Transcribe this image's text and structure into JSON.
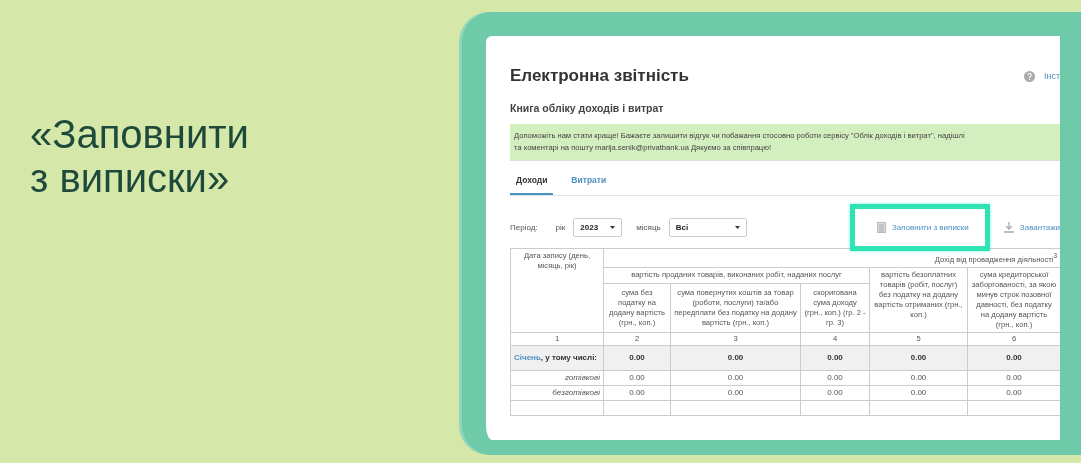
{
  "heading": "«Заповнити з виписки»",
  "app": {
    "title": "Електронна звітність",
    "help_link": "Інст",
    "subtitle": "Книга обліку доходів і витрат",
    "notice_lines": [
      "Допоможіть нам стати краще! Бажаєте залишити відгук чи побажання стосовно роботи сервісу \"Облік доходів і витрат\", надішлі",
      "та коментарі на пошту marija.senik@privatbank.ua Дякуємо за співпрацю!"
    ],
    "tabs": [
      {
        "label": "Доходи",
        "selected": true
      },
      {
        "label": "Витрати",
        "selected": false
      }
    ],
    "filters": {
      "period_label": "Період:",
      "year_label": "рік",
      "year": "2023",
      "month_label": "місяць",
      "month": "Всі"
    },
    "actions": [
      {
        "kind": "list",
        "label": "Заповнити з виписки",
        "highlighted": true
      },
      {
        "kind": "download",
        "label": "Завантажи",
        "highlighted": false
      }
    ],
    "table": {
      "date_header": "Дата запису (день, місяць, рік)",
      "income_header": "Дохід від провадження діяльності$^{3}$",
      "sales_header": "вартість проданих товарів, виконаних робіт, наданих послуг",
      "sales_columns": [
        "сума без податку на додану вартість (грн., коп.)",
        "сума повернутих коштів за товар (роботи, послуги) та/або передплати без податку на додану вартість (грн., коп.)",
        "скоригована сума доходу (грн., коп.) (гр. 2 - гр. 3)"
      ],
      "free_goods_header": "вартість безоплатних товарів (робіт, послуг) без податку на додану вартість отриманих (грн., коп.)",
      "payables_header": "сума кредиторської заборгованості, за якою минув строк позовної давності, без податку на додану вартість (грн., коп.)",
      "column_numbers": [
        "1",
        "2",
        "3",
        "4",
        "5",
        "6"
      ],
      "rows": [
        {
          "kind": "month",
          "month": "Січень",
          "suffix": ", у тому числі:",
          "values": [
            "0.00",
            "0.00",
            "0.00",
            "0.00",
            "0.00"
          ]
        },
        {
          "kind": "sub",
          "label": "готівкові",
          "values": [
            "0.00",
            "0.00",
            "0.00",
            "0.00",
            "0.00"
          ]
        },
        {
          "kind": "sub",
          "label": "безготівкові",
          "values": [
            "0.00",
            "0.00",
            "0.00",
            "0.00",
            "0.00"
          ]
        }
      ]
    }
  }
}
